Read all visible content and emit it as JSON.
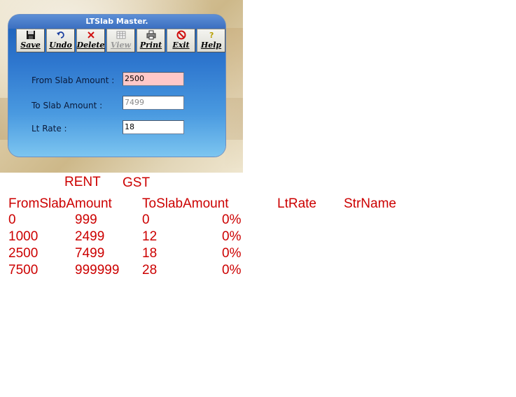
{
  "window": {
    "title": "LTSlab Master."
  },
  "toolbar": [
    {
      "key": "save",
      "label": "Save",
      "icon": "floppy-disk",
      "disabled": false
    },
    {
      "key": "undo",
      "label": "Undo",
      "icon": "undo-arrow",
      "disabled": false
    },
    {
      "key": "delete",
      "label": "Delete",
      "icon": "red-x",
      "disabled": false
    },
    {
      "key": "view",
      "label": "View",
      "icon": "grid",
      "disabled": true
    },
    {
      "key": "print",
      "label": "Print",
      "icon": "printer",
      "disabled": false
    },
    {
      "key": "exit",
      "label": "Exit",
      "icon": "no-entry",
      "disabled": false
    },
    {
      "key": "help",
      "label": "Help",
      "icon": "question",
      "disabled": false
    }
  ],
  "form": {
    "from_label": "From Slab Amount :",
    "from_value": "2500",
    "to_label": "To Slab Amount :",
    "to_value": "7499",
    "rate_label": "Lt Rate :",
    "rate_value": "18"
  },
  "sheet": {
    "group1": "RENT",
    "group2": "GST",
    "headers": [
      "FromSlabAmount",
      "ToSlabAmount",
      "LtRate",
      "StrName"
    ],
    "rows": [
      [
        "0",
        "999",
        "0",
        "0%"
      ],
      [
        "1000",
        "2499",
        "12",
        "0%"
      ],
      [
        "2500",
        "7499",
        "18",
        "0%"
      ],
      [
        "7500",
        "999999",
        "28",
        "0%"
      ]
    ]
  },
  "colors": {
    "sheet_text": "#cc0000",
    "title_bar": "#3b6fc0",
    "from_field_bg": "#ffc8c8"
  }
}
